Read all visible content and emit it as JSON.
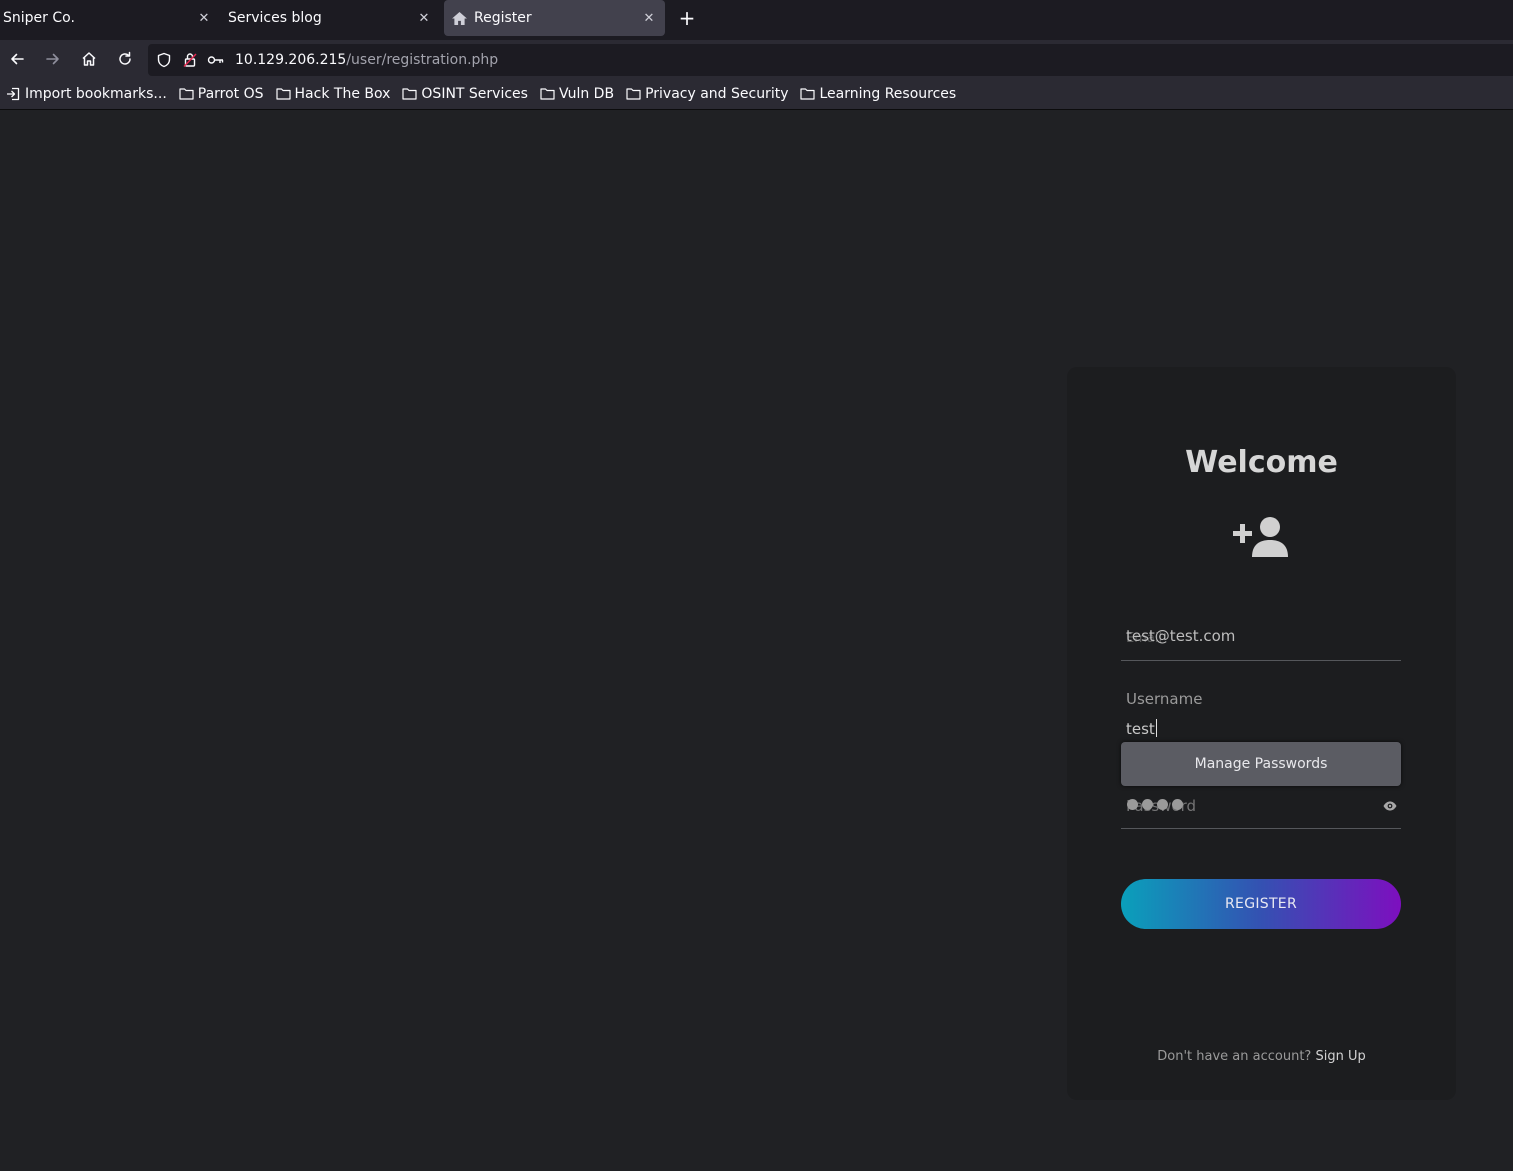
{
  "tabs": [
    {
      "title": "Sniper Co.",
      "active": false
    },
    {
      "title": "Services blog",
      "active": false
    },
    {
      "title": "Register",
      "active": true
    }
  ],
  "nav": {
    "url_host": "10.129.206.215",
    "url_path": "/user/registration.php"
  },
  "bookmarks": [
    {
      "label": "Import bookmarks...",
      "icon": "import-icon"
    },
    {
      "label": "Parrot OS",
      "icon": "folder-icon"
    },
    {
      "label": "Hack The Box",
      "icon": "folder-icon"
    },
    {
      "label": "OSINT Services",
      "icon": "folder-icon"
    },
    {
      "label": "Vuln DB",
      "icon": "folder-icon"
    },
    {
      "label": "Privacy and Security",
      "icon": "folder-icon"
    },
    {
      "label": "Learning Resources",
      "icon": "folder-icon"
    }
  ],
  "form": {
    "title": "Welcome",
    "email_label": "Email",
    "email_value": "test@test.com",
    "username_label": "Username",
    "username_value": "test",
    "password_label": "Password",
    "password_dots": 4,
    "manage_passwords": "Manage Passwords",
    "register_label": "REGISTER",
    "signup_prompt": "Don't have an account?",
    "signup_link": "Sign Up"
  },
  "colors": {
    "gradient_start": "#0aa0bb",
    "gradient_end": "#7d0fbf",
    "card_bg": "#1c1d1f",
    "page_bg": "#202124"
  }
}
